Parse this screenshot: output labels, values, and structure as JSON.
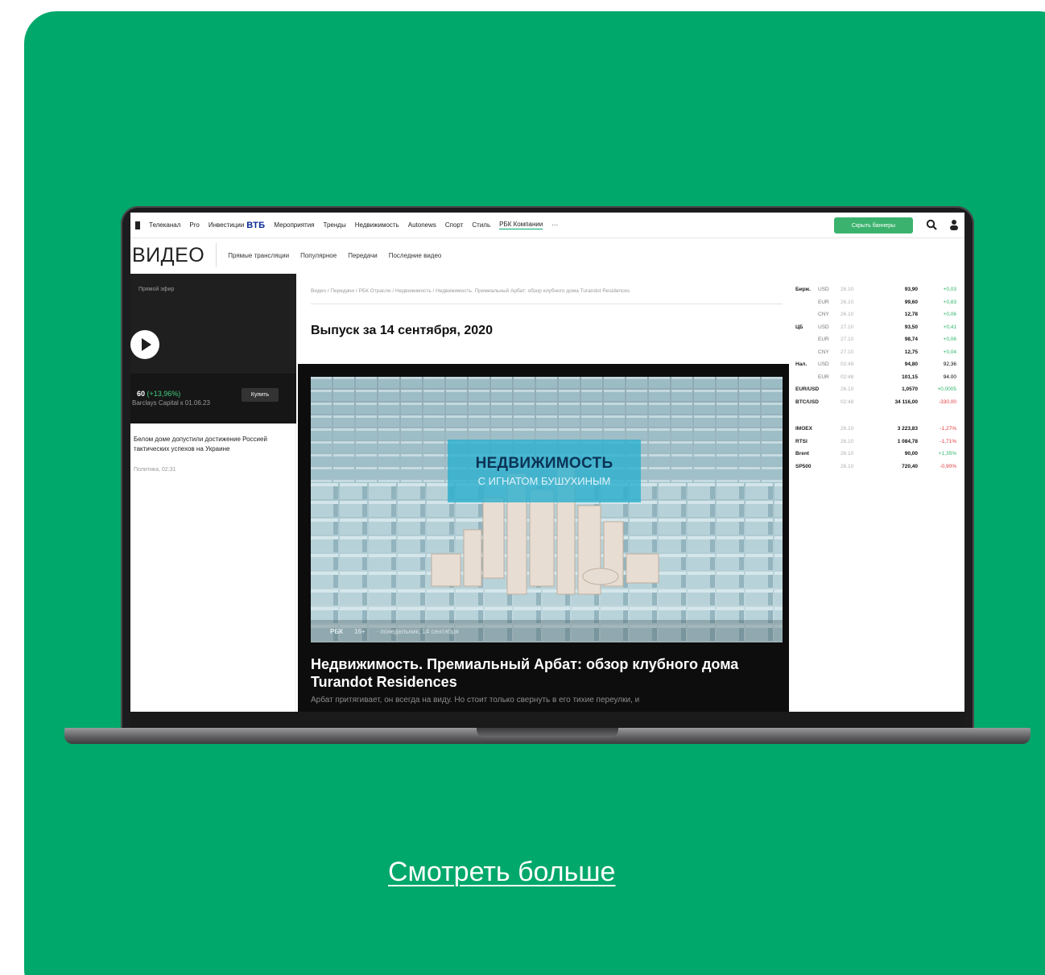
{
  "nav": {
    "items": [
      "Телеканал",
      "Pro",
      "Инвестиции",
      "Мероприятия",
      "Тренды",
      "Недвижимость",
      "Autonews",
      "Спорт",
      "Стиль",
      "РБК Компании",
      "···"
    ],
    "vtb_logo": "ВТБ",
    "hide_banners": "Скрыть баннеры"
  },
  "section": {
    "title": "ВИДЕО",
    "links": [
      "Прямые трансляции",
      "Популярное",
      "Передачи",
      "Последние видео"
    ]
  },
  "left": {
    "live_label": "Прямой эфир",
    "ticker_value": "60",
    "ticker_change": "(+13,96%)",
    "ticker_note": "Barclays Capital к 01.06.23",
    "buy_label": "Купить",
    "news_text": "Белом доме допустили достижение Россией тактических успехов на Украине",
    "news_meta": "Политика, 02:31"
  },
  "breadcrumb": "Видео / Передачи / РБК Отрасли / Недвижимость / Недвижимость. Премиальный Арбат: обзор клубного дома Turandot Residences",
  "issue_title": "Выпуск за 14 сентября, 2020",
  "video": {
    "show_title": "НЕДВИЖИМОСТЬ",
    "show_subtitle": "С ИГНАТОМ БУШУХИНЫМ",
    "channel": "РБК",
    "age": "16+",
    "date": "· понедельник, 14 сентября",
    "article_title": "Недвижимость. Премиальный Арбат: обзор клубного дома Turandot Residences",
    "article_lead": "Арбат притягивает, он всегда на виду. Но стоит только свернуть в его тихие переулки, и"
  },
  "rates": {
    "rows": [
      {
        "group": "Бирж.",
        "cur": "USD",
        "date": "26.10",
        "val": "93,90",
        "chg": "+0,03",
        "dir": "up"
      },
      {
        "group": "",
        "cur": "EUR",
        "date": "26.10",
        "val": "99,60",
        "chg": "+0,83",
        "dir": "up"
      },
      {
        "group": "",
        "cur": "CNY",
        "date": "26.10",
        "val": "12,78",
        "chg": "+0,06",
        "dir": "up"
      },
      {
        "group": "ЦБ",
        "cur": "USD",
        "date": "27.10",
        "val": "93,50",
        "chg": "+0,41",
        "dir": "up"
      },
      {
        "group": "",
        "cur": "EUR",
        "date": "27.10",
        "val": "98,74",
        "chg": "+0,06",
        "dir": "up"
      },
      {
        "group": "",
        "cur": "CNY",
        "date": "27.10",
        "val": "12,75",
        "chg": "+0,04",
        "dir": "up"
      },
      {
        "group": "Нал.",
        "cur": "USD",
        "date": "02:48",
        "val": "94,80",
        "chg": "92,36",
        "dir": "neutral"
      },
      {
        "group": "",
        "cur": "EUR",
        "date": "02:48",
        "val": "101,15",
        "chg": "94.00",
        "dir": "neutral"
      },
      {
        "group": "EUR/USD",
        "cur": "",
        "date": "26.10",
        "val": "1,0570",
        "chg": "+0,0005",
        "dir": "up"
      },
      {
        "group": "BTC/USD",
        "cur": "",
        "date": "02:48",
        "val": "34 116,00",
        "chg": "-330,00",
        "dir": "down"
      }
    ],
    "indexes": [
      {
        "group": "IMOEX",
        "date": "26.10",
        "val": "3 223,83",
        "chg": "-1,27%",
        "dir": "down"
      },
      {
        "group": "RTSI",
        "date": "26.10",
        "val": "1 084,78",
        "chg": "-1,71%",
        "dir": "down"
      },
      {
        "group": "Brent",
        "date": "26.10",
        "val": "90,00",
        "chg": "+1,35%",
        "dir": "up"
      },
      {
        "group": "SP500",
        "date": "26.10",
        "val": "720,40",
        "chg": "-0,90%",
        "dir": "down"
      }
    ]
  },
  "more_link": "Смотреть больше",
  "colors": {
    "brand_green": "#00a86b",
    "button_green": "#3bb36e",
    "dark_panel": "#1f1f1f"
  }
}
